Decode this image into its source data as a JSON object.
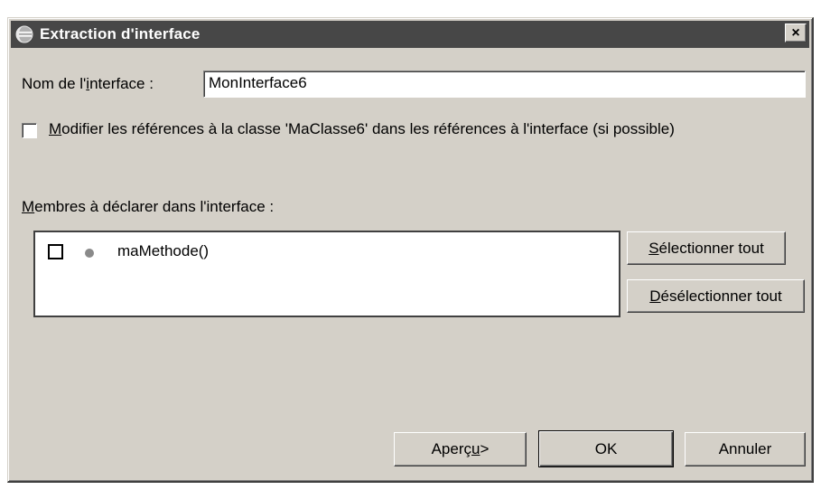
{
  "window": {
    "title": "Extraction d'interface",
    "close_label": "×"
  },
  "name_field": {
    "label_pre": "Nom de l'",
    "label_mnemonic": "i",
    "label_post": "nterface :",
    "value": "MonInterface6"
  },
  "modify_checkbox": {
    "checked": false,
    "label_mnemonic": "M",
    "label_rest": "odifier les références à la classe 'MaClasse6' dans les références à l'interface (si possible)"
  },
  "members": {
    "label_mnemonic": "M",
    "label_rest": "embres à déclarer dans l'interface :",
    "items": [
      {
        "label": "maMethode()",
        "checked": false,
        "icon": "method-default-icon"
      }
    ]
  },
  "side_buttons": {
    "select_all_mnemonic": "S",
    "select_all_rest": "électionner tout",
    "deselect_all_mnemonic": "D",
    "deselect_all_rest": "ésélectionner tout"
  },
  "footer": {
    "preview_pre": "Aperç",
    "preview_mnemonic": "u",
    "preview_post": " >",
    "ok_label": "OK",
    "cancel_label": "Annuler"
  },
  "colors": {
    "dialog_background": "#d4d0c8",
    "titlebar": "#474747",
    "method_icon": "#8a8a8a"
  }
}
